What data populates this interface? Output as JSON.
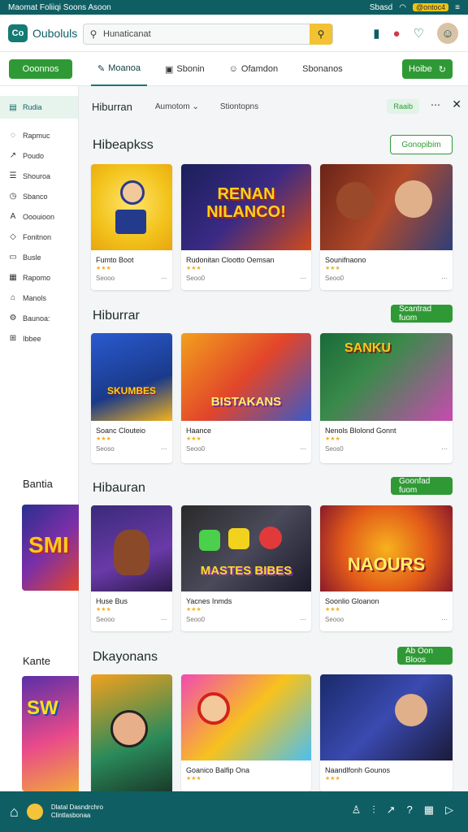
{
  "status": {
    "left": "Maomat Foliiqi Soons Asoon",
    "right": "Sbasd",
    "battery": "@ontoc4"
  },
  "app": {
    "name": "Ouboluls",
    "logo": "Co"
  },
  "search": {
    "value": "Hunaticanat",
    "icon": "search-icon"
  },
  "toolbar": {
    "primary": "Ooonnos",
    "tabs": [
      "Moanoa",
      "Sbonin",
      "Ofamdon",
      "Sbonanos"
    ],
    "right": "Hoibe"
  },
  "sidebar": {
    "items": [
      "Rudia",
      "Rapmuc",
      "Poudo",
      "Shouroa",
      "Sbanco",
      "Ooouioon",
      "Fonitnon",
      "Busle",
      "Rapomo",
      "Manols",
      "Baunoa:",
      "Ibbee"
    ],
    "label2": "Bantia",
    "label3": "Kante"
  },
  "main": {
    "header": {
      "title": "Hiburran",
      "filter1": "Aumotom",
      "filter2": "Stiontopns",
      "chip": "Raaib"
    }
  },
  "sections": [
    {
      "title": "Hibeapkss",
      "button": "Gonopibim",
      "cards": [
        {
          "title": "Fumto Boot",
          "meta": "Seooo"
        },
        {
          "title": "Rudonitan Clootto Oemsan",
          "meta": "Seoo0"
        },
        {
          "title": "Sounifnaono",
          "meta": "Seoo0"
        }
      ]
    },
    {
      "title": "Hiburrar",
      "button": "Scantrad fuom",
      "cards": [
        {
          "title": "Soanc Clouteio",
          "meta": "Seoso"
        },
        {
          "title": "Haance",
          "meta": "Seoo0"
        },
        {
          "title": "Nenols Blolond Gonnt",
          "meta": "Seos0"
        }
      ]
    },
    {
      "title": "Hibauran",
      "button": "Goonfad fuom",
      "cards": [
        {
          "title": "Huse Bus",
          "meta": "Seooo"
        },
        {
          "title": "Yacnes Inmds",
          "meta": "Seoo0"
        },
        {
          "title": "Soonlio Gloanon",
          "meta": "Seooo"
        }
      ]
    },
    {
      "title": "Dkayonans",
      "button": "Ab Oon Bloos",
      "cards": [
        {
          "title": "",
          "meta": ""
        },
        {
          "title": "Goanico Balfip Ona",
          "meta": ""
        },
        {
          "title": "Naandlfonh Gounos",
          "meta": ""
        }
      ]
    }
  ],
  "card_art": {
    "s0c1": "RENAN NILANCO!",
    "s1c0": "SKUMBES",
    "s1c1": "BISTAKANS",
    "s1c2": "SANKU",
    "s2c1": "MASTES BIBES",
    "s2c2": "NAOURS",
    "side1": "SMI",
    "side2": "SW"
  },
  "bottom": {
    "line1": "Dlatal Dasndrchro",
    "line2": "Clintlasbonaa"
  },
  "colors": {
    "brand": "#0f5e63",
    "accent": "#2f9a35",
    "search_btn": "#f2c233"
  }
}
